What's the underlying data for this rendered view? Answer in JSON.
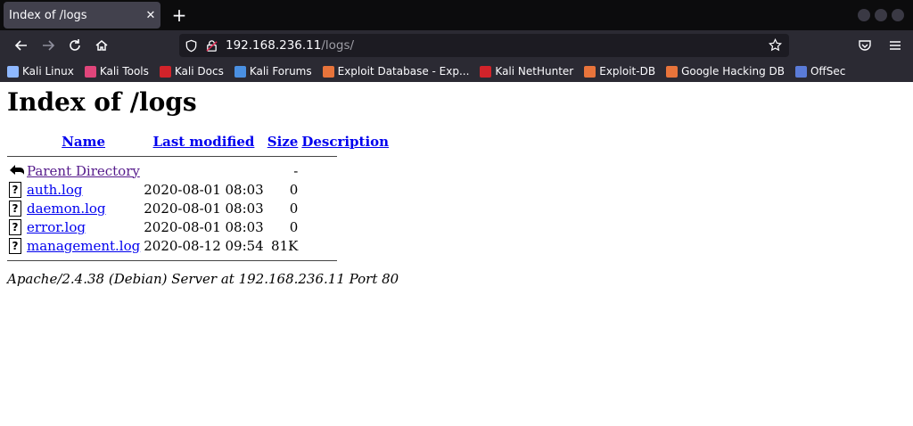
{
  "browser": {
    "tab_title": "Index of /logs",
    "tab_close": "✕",
    "new_tab": "+",
    "url_host": "192.168.236.11",
    "url_path": "/logs/",
    "bookmarks": [
      {
        "label": "Kali Linux",
        "color": "#8fb8ff"
      },
      {
        "label": "Kali Tools",
        "color": "#e0457b"
      },
      {
        "label": "Kali Docs",
        "color": "#d2232a"
      },
      {
        "label": "Kali Forums",
        "color": "#4a90e2"
      },
      {
        "label": "Exploit Database - Exp...",
        "color": "#e8743b"
      },
      {
        "label": "Kali NetHunter",
        "color": "#d2232a"
      },
      {
        "label": "Exploit-DB",
        "color": "#e8743b"
      },
      {
        "label": "Google Hacking DB",
        "color": "#e8743b"
      },
      {
        "label": "OffSec",
        "color": "#5a7bd8"
      }
    ]
  },
  "page": {
    "heading": "Index of /logs",
    "columns": {
      "name": "Name",
      "last_modified": "Last modified",
      "size": "Size",
      "description": "Description"
    },
    "parent": {
      "name": "Parent Directory",
      "size": "-"
    },
    "rows": [
      {
        "name": "auth.log",
        "modified": "2020-08-01 08:03",
        "size": "0"
      },
      {
        "name": "daemon.log",
        "modified": "2020-08-01 08:03",
        "size": "0"
      },
      {
        "name": "error.log",
        "modified": "2020-08-01 08:03",
        "size": "0"
      },
      {
        "name": "management.log",
        "modified": "2020-08-12 09:54",
        "size": "81K"
      }
    ],
    "file_icon_glyph": "?",
    "footer": "Apache/2.4.38 (Debian) Server at 192.168.236.11 Port 80"
  }
}
